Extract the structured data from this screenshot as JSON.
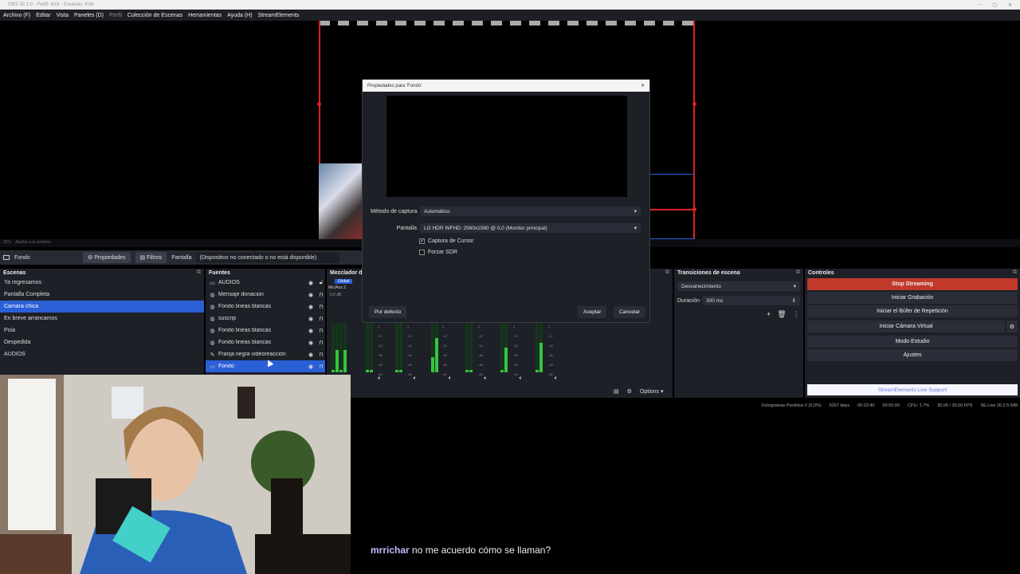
{
  "window": {
    "title": "OBS 32.1.0 - Perfil: Kick - Escenas: Kick"
  },
  "menu": [
    "Archivo (F)",
    "Editar",
    "Vista",
    "Paneles (D)",
    "Perfil",
    "Colección de Escenas",
    "Herramientas",
    "Ayuda (H)",
    "StreamElements"
  ],
  "preview": {
    "zoom_hint": "25%",
    "fit_label": "Ajustar a la ventana"
  },
  "source_toolbar": {
    "selected_source": "Fondo",
    "props_label": "Propiedades",
    "filters_label": "Filtros",
    "pantalla_label": "Pantalla",
    "device_status": "(Dispositivo no conectado o no está disponible)"
  },
  "scenes": {
    "title": "Escenas",
    "items": [
      "Ya regresamos",
      "Pantalla Completa",
      "Camara chica",
      "En breve arrancamos",
      "Poia",
      "Despedida",
      "AUDIOS"
    ],
    "selected": "Camara chica"
  },
  "sources": {
    "title": "Fuentes",
    "items": [
      {
        "label": "AUDIOS",
        "icon": "folder-icon"
      },
      {
        "label": "Mensaje donacion",
        "icon": "globe-icon"
      },
      {
        "label": "Fondo lineas blancas",
        "icon": "globe-icon"
      },
      {
        "label": "suscrip",
        "icon": "globe-icon"
      },
      {
        "label": "Fondo lineas blancas",
        "icon": "globe-icon"
      },
      {
        "label": "Fondo lineas blancas",
        "icon": "globe-icon"
      },
      {
        "label": "Franja negra videoreacción",
        "icon": "brush-icon"
      },
      {
        "label": "Fondo",
        "icon": "monitor-icon"
      }
    ],
    "selected": "Fondo"
  },
  "mixer": {
    "title": "Mezclador de",
    "global": "Global",
    "channel": "Mic/Aux 2",
    "db": "0.0 dB",
    "scale": [
      "0",
      "-6",
      "-12",
      "-18",
      "-24",
      "-30",
      "-36",
      "-42",
      "-48",
      "-54",
      "-60"
    ],
    "levels": [
      0.05,
      0.45,
      0.05,
      0.45,
      0.05,
      0.05,
      0.05,
      0.05,
      0.3,
      0.7,
      0.05,
      0.05,
      0.05,
      0.5,
      0.05,
      0.6
    ],
    "options_label": "Options"
  },
  "transitions": {
    "title": "Transiciones de escena",
    "type": "Desvanecimiento",
    "duration_label": "Duración",
    "duration_value": "300 ms"
  },
  "controls": {
    "title": "Controles",
    "stop_streaming": "Stop Streaming",
    "start_recording": "Iniciar Grabación",
    "replay_buffer": "Iniciar el Búfer de Repetición",
    "virtual_camera": "Iniciar Cámara Virtual",
    "studio_mode": "Modo Estudio",
    "settings": "Ajustes",
    "se_support": "StreamElements Live Support",
    "colors": {
      "stop": "#c0392b",
      "accent": "#2a5fd6"
    }
  },
  "status": {
    "dropped": "Fotogramas Perdidos 0 (0,0%)",
    "bitrate": "6267 kbps",
    "time": "00:22:40",
    "rec_time": "00:00:00",
    "cpu": "CPU: 1.7%",
    "fps": "30.00 / 30.00 FPS",
    "se": "SE.Live 26.2.5.549"
  },
  "dialog": {
    "title": "Propiedades para 'Fondo'",
    "method_label": "Método de captura",
    "method_value": "Automático",
    "screen_label": "Pantalla",
    "screen_value": "LG HDR WFHD: 2560x1080 @ 0,0 (Monitor principal)",
    "cursor_label": "Captura de Cursor",
    "cursor_checked": true,
    "sdr_label": "Forzar SDR",
    "sdr_checked": false,
    "defaults_label": "Por defecto",
    "ok_label": "Aceptar",
    "cancel_label": "Cancelar"
  },
  "chat": {
    "user": "mrrichar",
    "message": "no me acuerdo cómo se llaman?"
  }
}
